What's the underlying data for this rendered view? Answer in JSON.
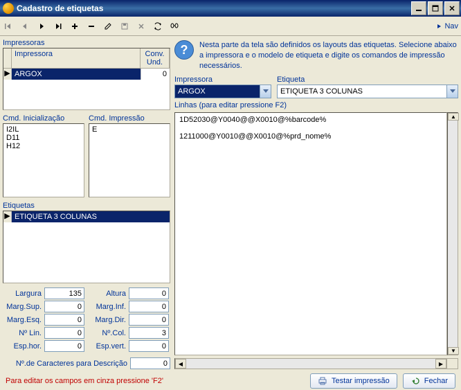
{
  "window": {
    "title": "Cadastro de etiquetas"
  },
  "toolbar": {
    "nav_label": "Nav"
  },
  "left": {
    "impressoras_label": "Impressoras",
    "impressoras_cols": {
      "impressora": "Impressora",
      "conv_und": "Conv. Und."
    },
    "impressoras_row": {
      "name": "ARGOX",
      "conv": "0"
    },
    "cmd_init_label": "Cmd. Inicialização",
    "cmd_init_text": "I2IL\nD11\nH12",
    "cmd_impr_label": "Cmd. Impressão",
    "cmd_impr_text": "E",
    "etiquetas_label": "Etiquetas",
    "etiquetas_row": "ETIQUETA 3 COLUNAS",
    "form": {
      "largura": "Largura",
      "largura_v": "135",
      "altura": "Altura",
      "altura_v": "0",
      "margsup": "Marg.Sup.",
      "margsup_v": "0",
      "marginf": "Marg.Inf.",
      "marginf_v": "0",
      "margesq": "Marg.Esq.",
      "margesq_v": "0",
      "margdir": "Marg.Dir.",
      "margdir_v": "0",
      "nlin": "Nº Lin.",
      "nlin_v": "0",
      "ncol": "Nº.Col.",
      "ncol_v": "3",
      "esphor": "Esp.hor.",
      "esphor_v": "0",
      "espvert": "Esp.vert.",
      "espvert_v": "0",
      "desc": "Nº.de Caracteres para Descrição",
      "desc_v": "0"
    }
  },
  "right": {
    "help_text": "Nesta parte da tela são definidos os layouts das etiquetas. Selecione abaixo a impressora e o modelo de etiqueta e digite os comandos de impressão necessários.",
    "impressora_label": "Impressora",
    "impressora_value": "ARGOX",
    "etiqueta_label": "Etiqueta",
    "etiqueta_value": "ETIQUETA 3 COLUNAS",
    "lines_label": "Linhas (para editar pressione F2)",
    "editor_text": "1D52030@Y0040@@X0010@%barcode%\n\n1211000@Y0010@@X0010@%prd_nome%"
  },
  "footer": {
    "hint": "Para editar os campos em cinza pressione 'F2'",
    "test_label": "Testar impressão",
    "close_label": "Fechar"
  }
}
